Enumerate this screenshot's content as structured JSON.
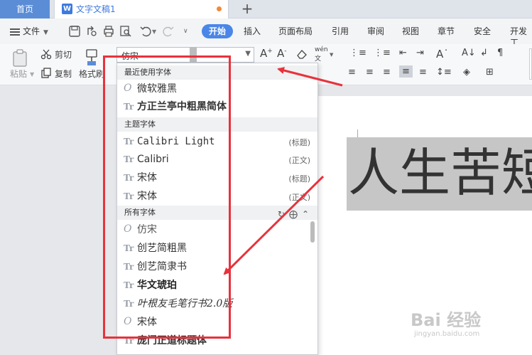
{
  "tabs": {
    "home": "首页",
    "doc_title": "文字文稿1",
    "new_tab": "+"
  },
  "menu": {
    "file": "文件",
    "items": [
      "开始",
      "插入",
      "页面布局",
      "引用",
      "审阅",
      "视图",
      "章节",
      "安全",
      "开发工"
    ]
  },
  "ribbon": {
    "paste": "粘贴",
    "cut": "剪切",
    "copy": "复制",
    "format_painter": "格式刷",
    "font_value": "仿宋"
  },
  "dropdown": {
    "section_recent": "最近使用字体",
    "recent_fonts": [
      {
        "name": "微软雅黑",
        "icon": "O"
      },
      {
        "name": "方正兰亭中粗黑简体",
        "icon": "Tr"
      }
    ],
    "section_theme": "主题字体",
    "theme_fonts": [
      {
        "name": "Calibri Light",
        "tag": "(标题)"
      },
      {
        "name": "Calibri",
        "tag": "(正文)"
      },
      {
        "name": "宋体",
        "tag": "(标题)"
      },
      {
        "name": "宋体",
        "tag": "(正文)"
      }
    ],
    "section_all": "所有字体",
    "all_fonts": [
      {
        "name": "仿宋",
        "icon": "O"
      },
      {
        "name": "创艺简粗黑",
        "icon": "Tr"
      },
      {
        "name": "创艺简隶书",
        "icon": "Tr"
      },
      {
        "name": "华文琥珀",
        "icon": "Tr"
      },
      {
        "name": "叶根友毛笔行书2.0版",
        "icon": "Tr"
      },
      {
        "name": "宋体",
        "icon": "O"
      },
      {
        "name": "庞门正道标题体",
        "icon": "Tr"
      }
    ]
  },
  "document": {
    "text": "人生苦短"
  },
  "watermark": {
    "brand": "Bai 经验",
    "url": "jingyan.baidu.com"
  },
  "colors": {
    "accent": "#4a86e8",
    "annotation": "#e8323c",
    "home_tab": "#5a8dd6"
  }
}
